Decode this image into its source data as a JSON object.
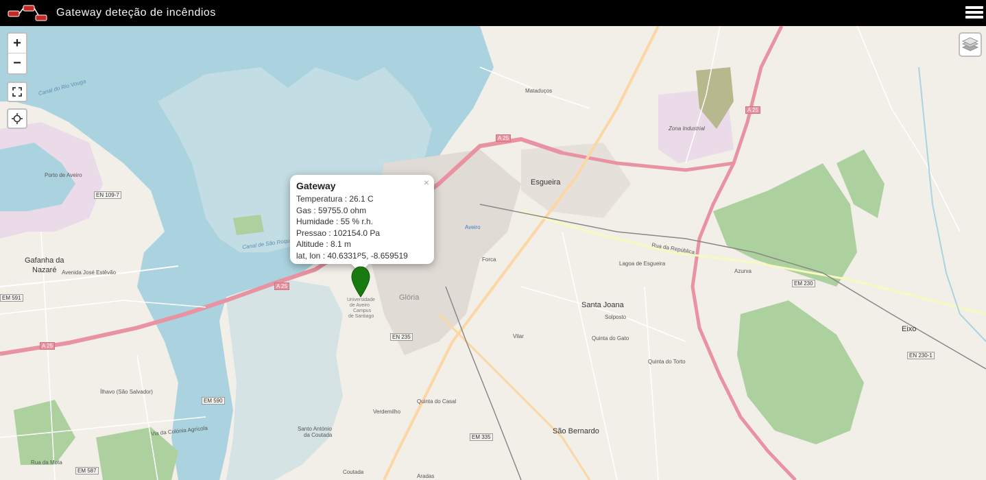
{
  "header": {
    "title": "Gateway deteção de incêndios"
  },
  "controls": {
    "zoom_in": "+",
    "zoom_out": "−"
  },
  "popup": {
    "title": "Gateway",
    "close": "×",
    "rows": [
      "Temperatura : 26.1 C",
      "Gas : 59755.0 ohm",
      "Humidade : 55 % r.h.",
      "Pressao : 102154.0 Pa",
      "Altitude : 8.1 m",
      "lat, lon : 40.633185, -8.659519"
    ]
  },
  "map_labels": {
    "porto_aveiro": "Porto de Aveiro",
    "gafanha": "Gafanha da",
    "gafanha2": "Nazaré",
    "esgueira": "Esgueira",
    "aveiro": "Aveiro",
    "gloria": "Glória",
    "santa_joana": "Santa Joana",
    "eixo": "Eixo",
    "sao_bernardo": "São Bernardo",
    "mataducos": "Mataduços",
    "zona_industrial": "Zona Industrial",
    "forca": "Forca",
    "vilar": "Vilar",
    "solposto": "Solposto",
    "quinta_gato": "Quinta do Gato",
    "quinta_torto": "Quinta do Torto",
    "quinta_casal": "Quinta do Casal",
    "verdemilho": "Verdemilho",
    "santo_antonio": "Santo António",
    "coutada": "da Coutada",
    "coutada2": "Coutada",
    "aradas": "Aradas",
    "lagoa": "Lagoa de Esgueira",
    "azurva": "Azurva",
    "ilhavo": "Ílhavo (São Salvador)",
    "universidade": "Universidade",
    "universidade2": "de Aveiro",
    "universidade3": "Campus",
    "universidade4": "de Santiago",
    "canal_vouga": "Canal do Rio Vouga",
    "canal_pirames": "Canal de São Roque",
    "rua_republica": "Rua da República",
    "avenida_estevao": "Avenida José Estêvão",
    "rua_mota": "Rua da Mota",
    "via_colonia": "Via da Colónia Agrícola"
  },
  "shields": {
    "a25_1": "A 25",
    "a25_2": "A 25",
    "a25_3": "A 25",
    "a25_4": "A 25",
    "en109": "EN 109-7",
    "em591": "EM 591",
    "en235": "EN 235",
    "em590": "EM 590",
    "em335": "EM 335",
    "em587": "EM 587",
    "em230": "EM 230",
    "en2301": "EN 230-1"
  },
  "colors": {
    "water": "#aad3df",
    "land": "#f2efe9",
    "motorway": "#e892a2",
    "primary": "#fcd6a4",
    "forest": "#add19e",
    "marker": "#1a7a12"
  }
}
